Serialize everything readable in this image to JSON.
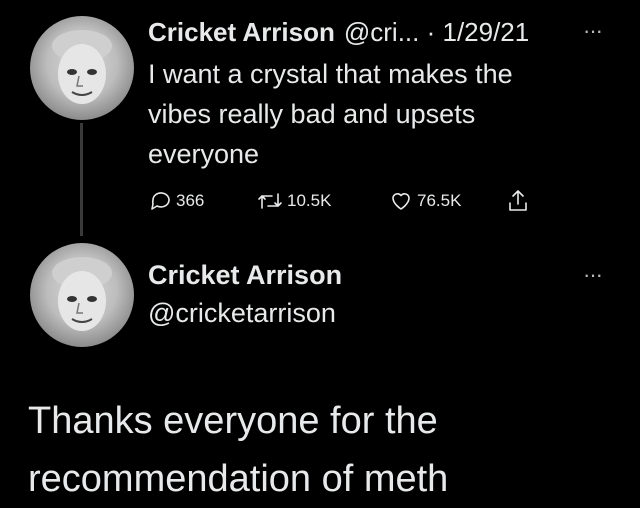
{
  "tweet1": {
    "name": "Cricket Arrison",
    "meta": "@cri... · 1/29/21",
    "more": "···",
    "text": "I want a crystal that makes the vibes really bad and upsets everyone",
    "replies": "366",
    "retweets": "10.5K",
    "likes": "76.5K",
    "icons": [
      "reply-icon",
      "retweet-icon",
      "like-icon",
      "share-icon"
    ]
  },
  "tweet2": {
    "name": "Cricket Arrison",
    "handle": "@cricketarrison",
    "more": "···",
    "text": "Thanks everyone for the recommendation of meth"
  }
}
